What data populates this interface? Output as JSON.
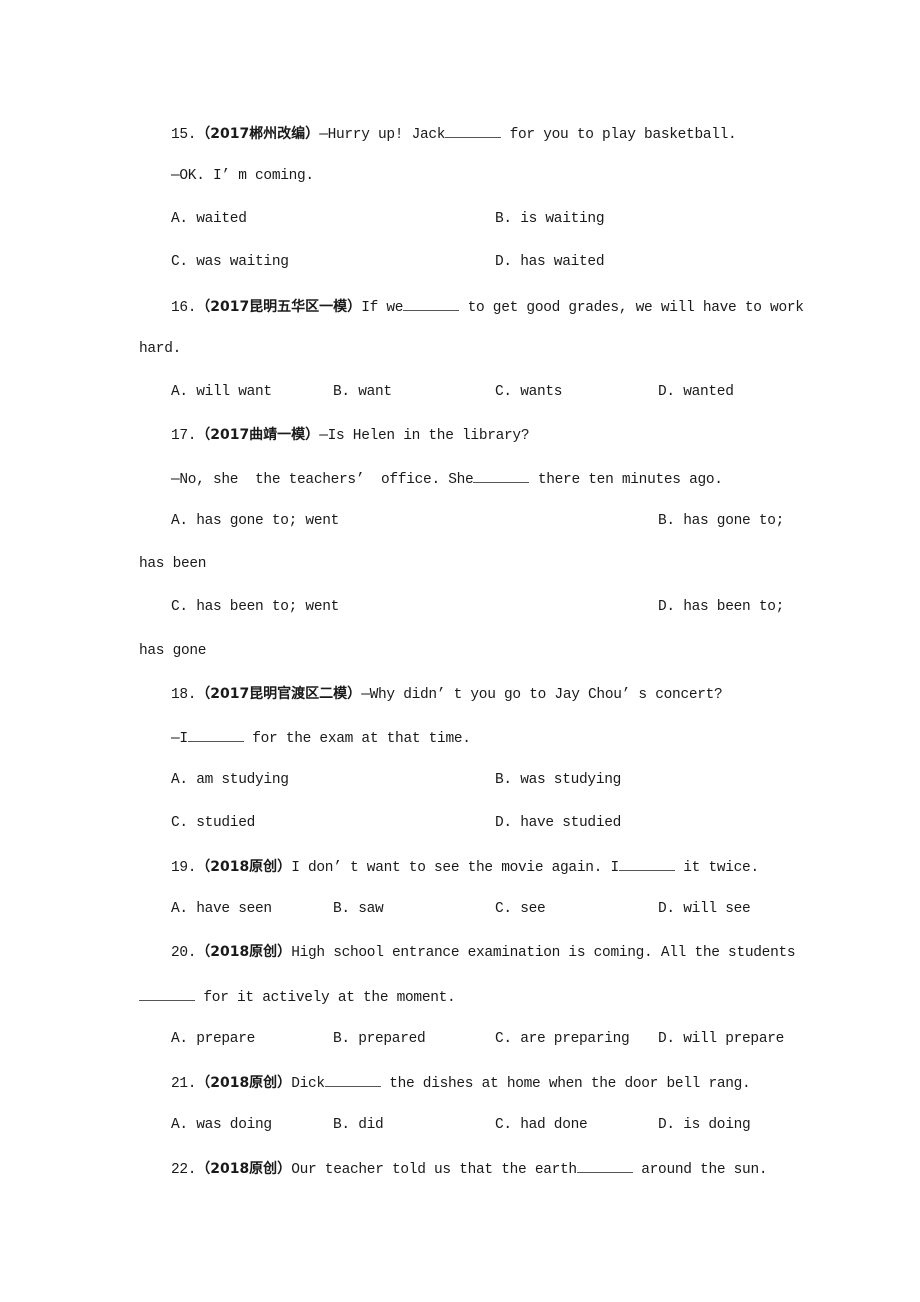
{
  "questions": [
    {
      "number": "15.",
      "source": "（2017郴州改编）",
      "stem_before": "—Hurry up! Jack",
      "stem_after": " for you to play basketball.",
      "reply": "—OK. I’ m coming.",
      "options": [
        "A. waited",
        "B. is waiting",
        "C. was waiting",
        "D. has waited"
      ]
    },
    {
      "number": "16.",
      "source": "（2017昆明五华区一模）",
      "stem_before": "If we",
      "stem_after": " to get good grades, we will have to work",
      "stem_cont": "hard.",
      "options": [
        "A. will want",
        "B. want",
        "C. wants",
        "D. wanted"
      ]
    },
    {
      "number": "17.",
      "source": "（2017曲靖一模）",
      "stem": "—Is Helen in the library?",
      "reply_before": "—No, she  the teachers’  office. She",
      "reply_after": " there ten minutes ago.",
      "options": [
        "A. has gone to; went",
        "B. has gone to;",
        "C. has been to; went",
        "D. has been to;"
      ],
      "option_b_cont": "has been",
      "option_d_cont": "has gone"
    },
    {
      "number": "18.",
      "source": "（2017昆明官渡区二模）",
      "stem": "—Why didn’ t you go to Jay Chou’ s concert?",
      "reply_before": "—I",
      "reply_after": " for the exam at that time.",
      "options": [
        "A. am studying",
        "B. was studying",
        "C. studied",
        "D. have studied"
      ]
    },
    {
      "number": "19.",
      "source": "（2018原创）",
      "stem_before": "I don’ t want to see the movie again. I",
      "stem_after": " it twice.",
      "options": [
        "A. have seen",
        "B. saw",
        "C. see",
        "D. will see"
      ]
    },
    {
      "number": "20.",
      "source": "（2018原创）",
      "stem": "High school entrance examination is coming. All the students",
      "stem_cont_after": " for it actively at the moment.",
      "options": [
        "A. prepare",
        "B. prepared",
        "C. are preparing",
        "D. will prepare"
      ]
    },
    {
      "number": "21.",
      "source": "（2018原创）",
      "stem_before": "Dick",
      "stem_after": " the dishes at home when the door bell rang.",
      "options": [
        "A. was doing",
        "B. did",
        "C. had done",
        "D. is doing"
      ]
    },
    {
      "number": "22.",
      "source": "（2018原创）",
      "stem_before": "Our teacher told us that the earth",
      "stem_after": " around the sun."
    }
  ]
}
